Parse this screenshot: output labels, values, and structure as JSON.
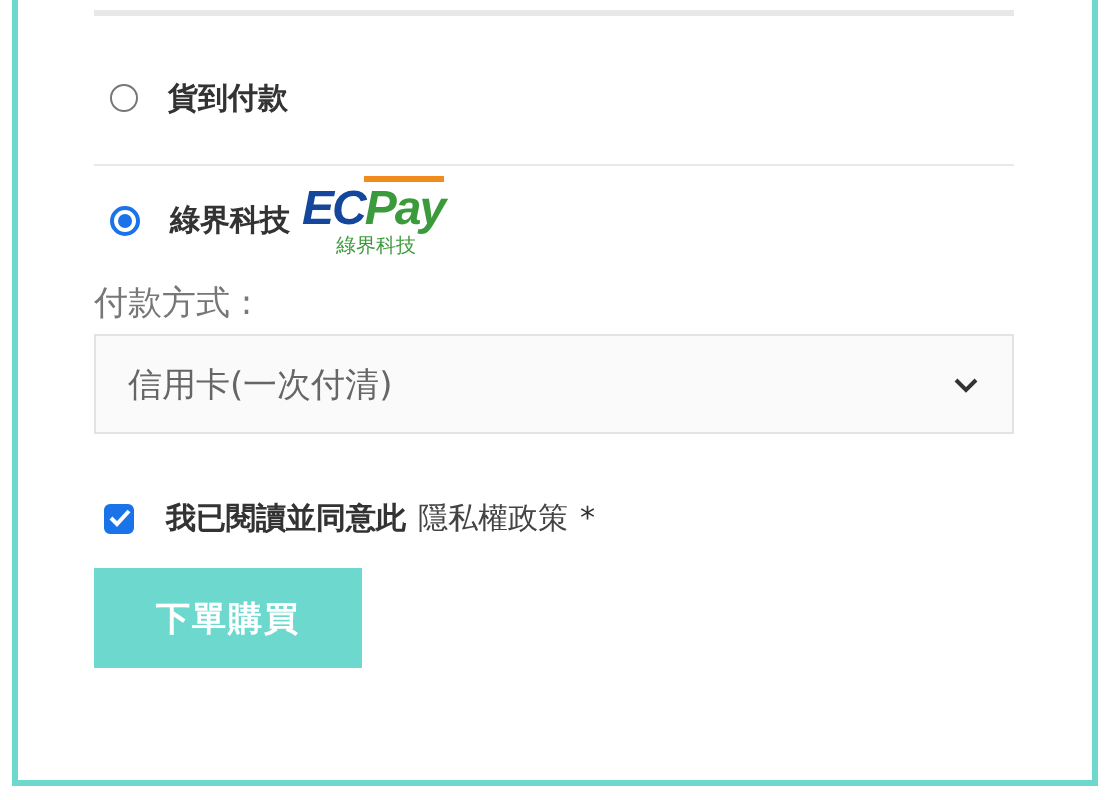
{
  "payment_options": [
    {
      "label": "貨到付款",
      "selected": false,
      "kind": "text"
    },
    {
      "label": "綠界科技",
      "selected": true,
      "kind": "logo",
      "logo_text": "ECPay",
      "logo_subtext": "綠界科技"
    }
  ],
  "payment_method": {
    "label": "付款方式 :",
    "value": "信用卡(一次付清)"
  },
  "agreement": {
    "checked": true,
    "text": "我已閱讀並同意此",
    "link": "隱私權政策",
    "required_mark": "*"
  },
  "submit_button": "下單購買"
}
